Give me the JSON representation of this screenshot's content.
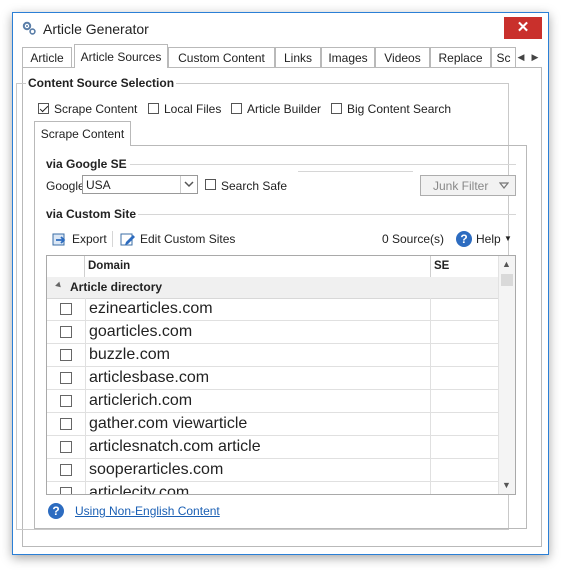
{
  "window": {
    "title": "Article Generator",
    "close_glyph": "✕"
  },
  "tabs": [
    "Article",
    "Article Sources",
    "Custom Content",
    "Links",
    "Images",
    "Videos",
    "Replace",
    "Sc"
  ],
  "active_tab": "Article Sources",
  "content_source": {
    "group_title": "Content Source Selection",
    "options": [
      {
        "label": "Scrape Content",
        "checked": true
      },
      {
        "label": "Local Files",
        "checked": false
      },
      {
        "label": "Article Builder",
        "checked": false
      },
      {
        "label": "Big Content Search",
        "checked": false
      }
    ]
  },
  "subtab": "Scrape Content",
  "google": {
    "section_title": "via Google SE",
    "label": "Google",
    "country_value": "USA",
    "search_safe_label": "Search Safe",
    "search_safe_checked": false,
    "junk_filter_label": "Junk Filter"
  },
  "custom_site": {
    "section_title": "via Custom Site",
    "export_label": "Export",
    "edit_label": "Edit Custom Sites",
    "sources_count": "0 Source(s)",
    "help_label": "Help"
  },
  "grid": {
    "columns": [
      "Domain",
      "SE"
    ],
    "group_label": "Article directory",
    "rows": [
      "ezinearticles.com",
      "goarticles.com",
      "buzzle.com",
      "articlesbase.com",
      "articlerich.com",
      "gather.com viewarticle",
      "articlesnatch.com article",
      "sooperarticles.com",
      "articlecity.com"
    ]
  },
  "footer": {
    "link_label": "Using Non-English Content"
  },
  "icons": {
    "app": "gear-icon",
    "export": "export-icon",
    "edit": "edit-icon",
    "help": "help-icon"
  },
  "colors": {
    "accent": "#2b7fd6",
    "close": "#c9302c",
    "link": "#1a5fb4"
  }
}
